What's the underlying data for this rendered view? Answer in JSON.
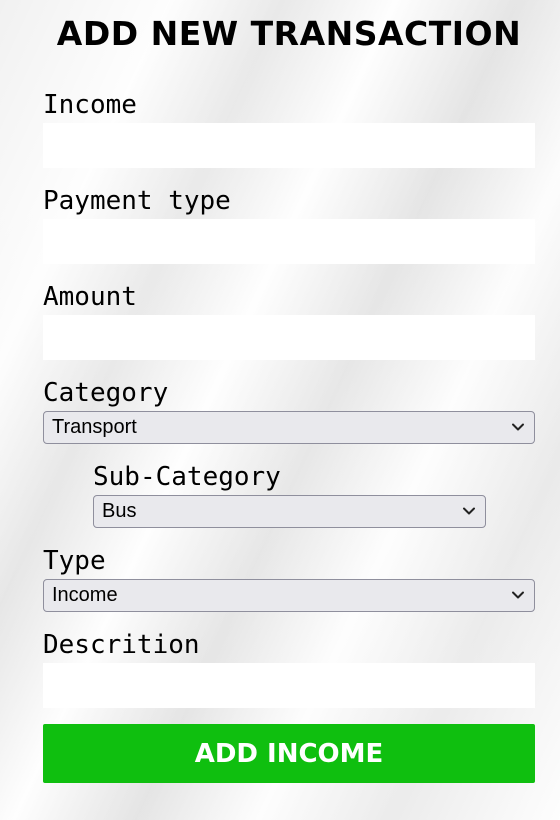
{
  "form": {
    "title": "ADD NEW TRANSACTION",
    "fields": {
      "income": {
        "label": "Income",
        "value": ""
      },
      "payment_type": {
        "label": "Payment type",
        "value": ""
      },
      "amount": {
        "label": "Amount",
        "value": ""
      },
      "category": {
        "label": "Category",
        "selected": "Transport"
      },
      "sub_category": {
        "label": "Sub-Category",
        "selected": "Bus"
      },
      "type": {
        "label": "Type",
        "selected": "Income"
      },
      "description": {
        "label": "Descrition",
        "value": ""
      }
    },
    "submit_label": "ADD INCOME"
  },
  "colors": {
    "submit_button": "#0fbf0f",
    "select_background": "#e9e9ed"
  },
  "icons": {
    "select_arrow": "chevron-down-icon"
  }
}
